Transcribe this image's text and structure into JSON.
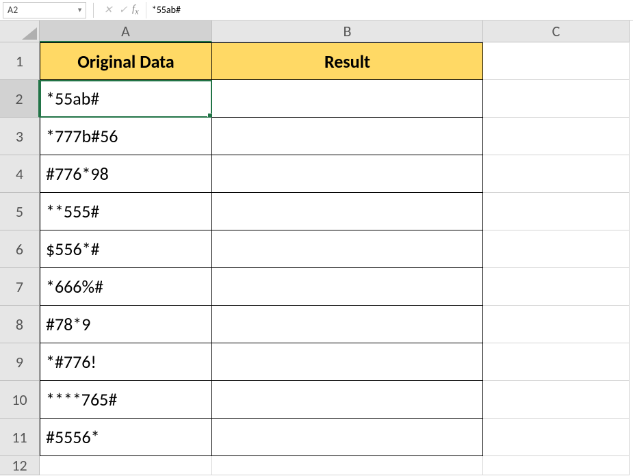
{
  "namebox": "A2",
  "formula": "*55ab#",
  "colheads": [
    "A",
    "B",
    "C"
  ],
  "rowheads": [
    "1",
    "2",
    "3",
    "4",
    "5",
    "6",
    "7",
    "8",
    "9",
    "10",
    "11",
    "12"
  ],
  "selected": {
    "col": 0,
    "row": 1
  },
  "header": {
    "A": "Original Data",
    "B": "Result"
  },
  "rows": [
    {
      "A": "*55ab#",
      "B": ""
    },
    {
      "A": "*777b#56",
      "B": ""
    },
    {
      "A": "#776*98",
      "B": ""
    },
    {
      "A": "**555#",
      "B": ""
    },
    {
      "A": "$556*#",
      "B": ""
    },
    {
      "A": "*666%#",
      "B": ""
    },
    {
      "A": "#78*9",
      "B": ""
    },
    {
      "A": "*#776!",
      "B": ""
    },
    {
      "A": "****765#",
      "B": ""
    },
    {
      "A": "#5556*",
      "B": ""
    }
  ]
}
